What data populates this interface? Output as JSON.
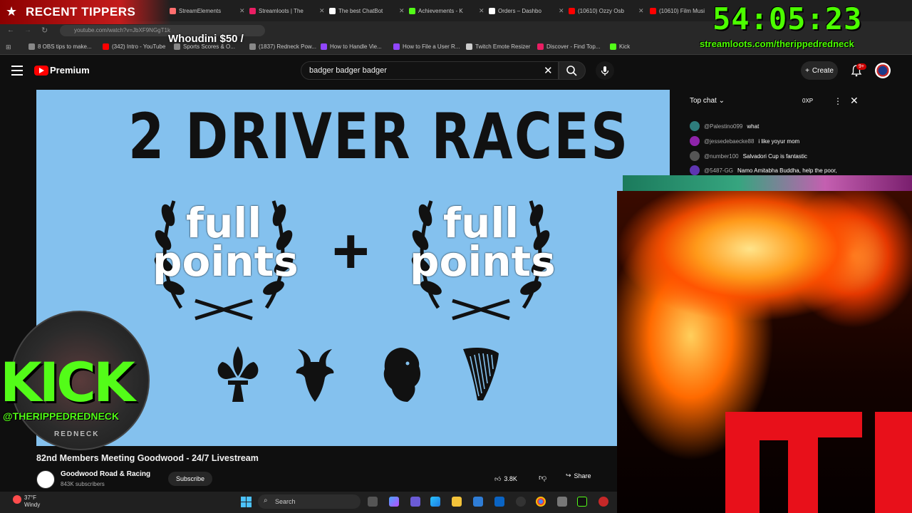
{
  "browser": {
    "tabs": [
      {
        "label": "StreamElements",
        "color": "#ff6e6e"
      },
      {
        "label": "Streamloots | The",
        "color": "#e91e63"
      },
      {
        "label": "The best ChatBot",
        "color": "#ffffff"
      },
      {
        "label": "Achievements - K",
        "color": "#53fc18"
      },
      {
        "label": "Orders – Dashbo",
        "color": "#ffffff"
      },
      {
        "label": "(10610) Ozzy Osb",
        "color": "#ff0000"
      },
      {
        "label": "(10610) Film Musi",
        "color": "#ff0000"
      }
    ],
    "address": "youtube.com/watch?v=JbXF9NGgT1k",
    "bookmarks": [
      {
        "label": "8 OBS tips to make...",
        "color": "#888888"
      },
      {
        "label": "(342) Intro - YouTube",
        "color": "#ff0000"
      },
      {
        "label": "Sports Scores & O...",
        "color": "#888888"
      },
      {
        "label": "(1837) Redneck Pow...",
        "color": "#888888"
      },
      {
        "label": "How to Handle Vie...",
        "color": "#9146ff"
      },
      {
        "label": "How to File a User R...",
        "color": "#9146ff"
      },
      {
        "label": "Twitch Emote Resizer",
        "color": "#cccccc"
      },
      {
        "label": "Discover - Find Top...",
        "color": "#e91e63"
      },
      {
        "label": "Kick",
        "color": "#53fc18"
      }
    ]
  },
  "youtube": {
    "premium_label": "Premium",
    "search_value": "badger badger badger",
    "create_label": "Create",
    "notifications_badge": "9+"
  },
  "video": {
    "headline": "2 DRIVER RACES",
    "left_badge": "full points",
    "right_badge": "full points",
    "plus": "+",
    "emblems": [
      "fleur-de-lis-icon",
      "goat-head-icon",
      "lion-icon",
      "harp-icon"
    ]
  },
  "below": {
    "title": "82nd Members Meeting Goodwood - 24/7 Livestream",
    "channel": "Goodwood Road & Racing",
    "subscribers": "843K subscribers",
    "subscribe_label": "Subscribe",
    "likes": "3.8K",
    "share_label": "Share"
  },
  "chat": {
    "header": "Top chat",
    "xp": "0XP",
    "messages": [
      {
        "user": "@Palestino099",
        "text": "what",
        "color": "#2e7d7d"
      },
      {
        "user": "@jessedebaecke88",
        "text": "i like yoyur mom",
        "color": "#8e24aa"
      },
      {
        "user": "@number100",
        "text": "Salvadori Cup is fantastic",
        "color": "#555555"
      },
      {
        "user": "@5487-GG",
        "text": "Namo Amitabha Buddha, help the poor,",
        "color": "#5e35b1"
      }
    ]
  },
  "overlays": {
    "recent_tippers": "RECENT TIPPERS",
    "tipper_ticker": "Whoudini $50 /",
    "timer": "54:05:23",
    "streamloots_link": "streamloots.com/therippedredneck",
    "kick_text": "KICK",
    "kick_handle": "@THERIPPEDREDNECK",
    "kick_sub": "REDNECK"
  },
  "taskbar": {
    "weather_temp": "37°F",
    "weather_desc": "Windy",
    "search_label": "Search"
  }
}
